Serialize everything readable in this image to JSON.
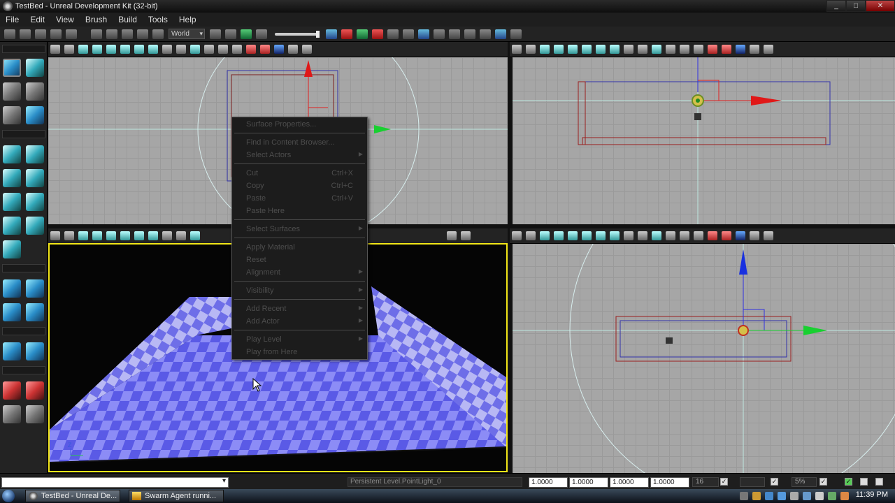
{
  "window": {
    "title": "TestBed - Unreal Development Kit (32-bit)",
    "minimize": "_",
    "maximize": "□",
    "close": "✕"
  },
  "menu": [
    "File",
    "Edit",
    "View",
    "Brush",
    "Build",
    "Tools",
    "Help"
  ],
  "toolbar": {
    "coord_system": "World"
  },
  "context_menu": {
    "items": [
      {
        "label": "Surface Properties...",
        "shortcut": "",
        "submenu": false
      },
      {
        "label": "Find in Content Browser...",
        "shortcut": "",
        "submenu": false
      },
      {
        "label": "Select Actors",
        "shortcut": "",
        "submenu": true
      },
      {
        "label": "Cut",
        "shortcut": "Ctrl+X",
        "submenu": false
      },
      {
        "label": "Copy",
        "shortcut": "Ctrl+C",
        "submenu": false
      },
      {
        "label": "Paste",
        "shortcut": "Ctrl+V",
        "submenu": false
      },
      {
        "label": "Paste Here",
        "shortcut": "",
        "submenu": false
      },
      {
        "label": "Select Surfaces",
        "shortcut": "",
        "submenu": true
      },
      {
        "label": "Apply Material",
        "shortcut": "",
        "submenu": false
      },
      {
        "label": "Reset",
        "shortcut": "",
        "submenu": false
      },
      {
        "label": "Alignment",
        "shortcut": "",
        "submenu": true
      },
      {
        "label": "Visibility",
        "shortcut": "",
        "submenu": true
      },
      {
        "label": "Add Recent",
        "shortcut": "",
        "submenu": true
      },
      {
        "label": "Add Actor",
        "shortcut": "",
        "submenu": true
      },
      {
        "label": "Play Level",
        "shortcut": "",
        "submenu": true
      },
      {
        "label": "Play from Here",
        "shortcut": "",
        "submenu": false
      }
    ]
  },
  "statusbar": {
    "level_actor": "Persistent Level.PointLight_0",
    "drag_values": [
      "1.0000",
      "1.0000",
      "1.0000",
      "1.0000"
    ],
    "grid_snap": "16",
    "rotation_snap": "",
    "scale_snap": "5%"
  },
  "taskbar": {
    "tasks": [
      "TestBed - Unreal De...",
      "Swarm Agent runni..."
    ],
    "clock": "11:39 PM"
  }
}
